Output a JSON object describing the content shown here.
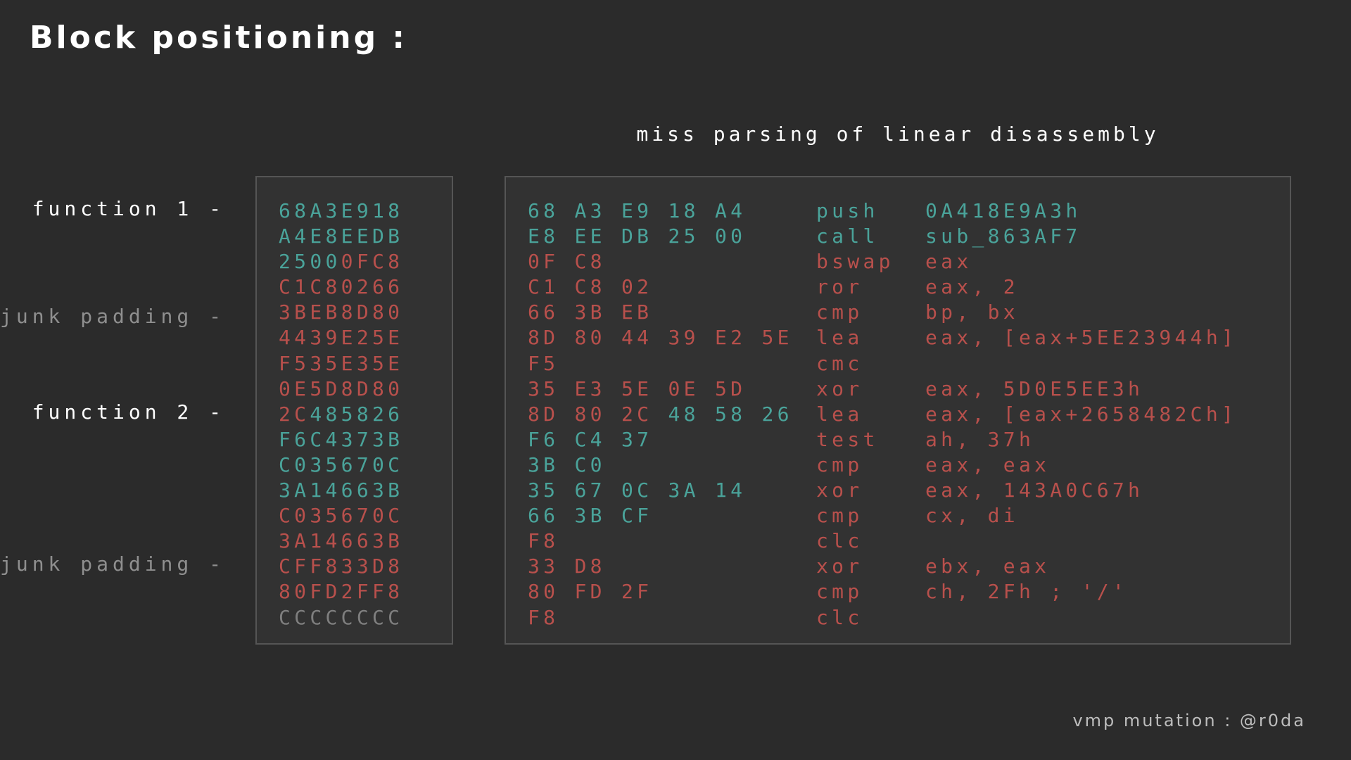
{
  "title": "Block positioning :",
  "caption": "miss parsing of linear disassembly",
  "footer": "vmp mutation : @r0da",
  "labels": {
    "function1": "function 1 -",
    "junk1": "junk padding -",
    "function2": "function 2 -",
    "junk2": "junk padding -"
  },
  "colors": {
    "function": "#4aa39a",
    "junk": "#b8504c",
    "padding": "#7f7f7f"
  },
  "hex_rows": [
    {
      "text": "68 A3 E9 18",
      "kind": "teal"
    },
    {
      "text": "A4 E8 EE DB",
      "kind": "teal"
    },
    {
      "text": "25 00 0F C8",
      "kind": "mixed1"
    },
    {
      "text": "C1 C8 02 66",
      "kind": "red"
    },
    {
      "text": "3B EB 8D 80",
      "kind": "red"
    },
    {
      "text": "44 39 E2 5E",
      "kind": "red"
    },
    {
      "text": "F5 35 E3 5E",
      "kind": "red"
    },
    {
      "text": "0E 5D 8D 80",
      "kind": "red"
    },
    {
      "text": "2C 48 58 26",
      "kind": "mixed2"
    },
    {
      "text": "F6 C4 37 3B",
      "kind": "teal"
    },
    {
      "text": "C0 35 67 0C",
      "kind": "teal"
    },
    {
      "text": "3A 14 66 3B",
      "kind": "teal"
    },
    {
      "text": "C0 35 67 0C",
      "kind": "red"
    },
    {
      "text": "3A 14 66 3B",
      "kind": "red"
    },
    {
      "text": "CF F8 33 D8",
      "kind": "red"
    },
    {
      "text": "80 FD 2F F8",
      "kind": "red"
    },
    {
      "text": "CC CC CC CC",
      "kind": "grey"
    }
  ],
  "disasm_rows": [
    {
      "bytes": "68 A3 E9 18 A4",
      "mnemonic": "push",
      "operands": "0A418E9A3h",
      "kind": "teal"
    },
    {
      "bytes": "E8 EE DB 25 00",
      "mnemonic": "call",
      "operands": "sub_863AF7",
      "kind": "teal"
    },
    {
      "bytes": "0F C8",
      "mnemonic": "bswap",
      "operands": "eax",
      "kind": "red"
    },
    {
      "bytes": "C1 C8 02",
      "mnemonic": "ror",
      "operands": "eax, 2",
      "kind": "red"
    },
    {
      "bytes": "66 3B EB",
      "mnemonic": "cmp",
      "operands": "bp, bx",
      "kind": "red"
    },
    {
      "bytes": "8D 80 44 39 E2 5E",
      "mnemonic": "lea",
      "operands": "eax, [eax+5EE23944h]",
      "kind": "red"
    },
    {
      "bytes": "F5",
      "mnemonic": "cmc",
      "operands": "",
      "kind": "red"
    },
    {
      "bytes": "35 E3 5E 0E 5D",
      "mnemonic": "xor",
      "operands": "eax, 5D0E5EE3h",
      "kind": "red"
    },
    {
      "bytes": "8D 80 2C 48 58 26",
      "mnemonic": "lea",
      "operands": "eax, [eax+2658482Ch]",
      "kind": "mixedA"
    },
    {
      "bytes": "F6 C4 37",
      "mnemonic": "test",
      "operands": "ah, 37h",
      "kind": "mixedB"
    },
    {
      "bytes": "3B C0",
      "mnemonic": "cmp",
      "operands": "eax, eax",
      "kind": "mixedB"
    },
    {
      "bytes": "35 67 0C 3A 14",
      "mnemonic": "xor",
      "operands": "eax, 143A0C67h",
      "kind": "mixedB"
    },
    {
      "bytes": "66 3B CF",
      "mnemonic": "cmp",
      "operands": "cx, di",
      "kind": "mixedB"
    },
    {
      "bytes": "F8",
      "mnemonic": "clc",
      "operands": "",
      "kind": "red"
    },
    {
      "bytes": "33 D8",
      "mnemonic": "xor",
      "operands": "ebx, eax",
      "kind": "red"
    },
    {
      "bytes": "80 FD 2F",
      "mnemonic": "cmp",
      "operands": "ch, 2Fh ; '/'",
      "kind": "red"
    },
    {
      "bytes": "F8",
      "mnemonic": "clc",
      "operands": "",
      "kind": "red"
    }
  ]
}
